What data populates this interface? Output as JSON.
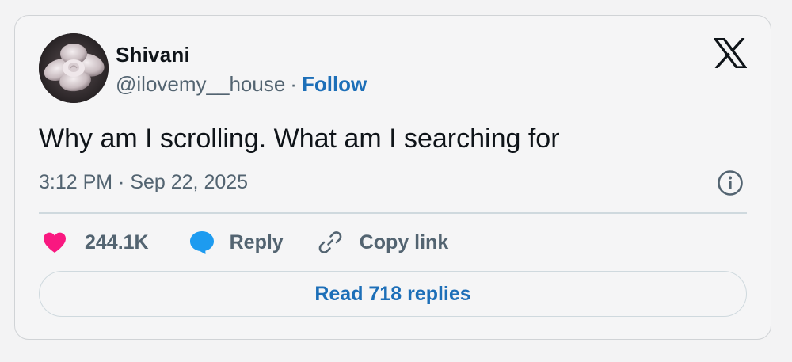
{
  "author": {
    "name": "Shivani",
    "handle": "@ilovemy__house",
    "separator": "·",
    "follow_label": "Follow",
    "avatar_icon": "flower-avatar"
  },
  "brand": {
    "logo": "x-logo-icon"
  },
  "tweet": {
    "text": "Why am I scrolling. What am I searching for",
    "timestamp": "3:12 PM · Sep 22, 2025"
  },
  "actions": {
    "like_count": "244.1K",
    "reply_label": "Reply",
    "copy_link_label": "Copy link"
  },
  "footer": {
    "read_replies_label": "Read 718 replies"
  },
  "colors": {
    "accent": "#1d6fb8",
    "like": "#f91880",
    "reply_icon": "#1d9bf0",
    "text_primary": "#0f1419",
    "text_secondary": "#536471",
    "border": "#cfd9de"
  }
}
